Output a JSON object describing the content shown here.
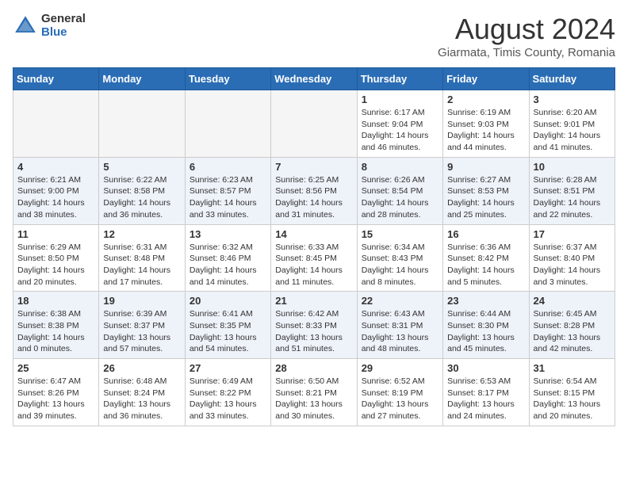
{
  "header": {
    "logo": {
      "general": "General",
      "blue": "Blue"
    },
    "month_year": "August 2024",
    "location": "Giarmata, Timis County, Romania"
  },
  "weekdays": [
    "Sunday",
    "Monday",
    "Tuesday",
    "Wednesday",
    "Thursday",
    "Friday",
    "Saturday"
  ],
  "weeks": [
    [
      {
        "day": "",
        "info": ""
      },
      {
        "day": "",
        "info": ""
      },
      {
        "day": "",
        "info": ""
      },
      {
        "day": "",
        "info": ""
      },
      {
        "day": "1",
        "info": "Sunrise: 6:17 AM\nSunset: 9:04 PM\nDaylight: 14 hours\nand 46 minutes."
      },
      {
        "day": "2",
        "info": "Sunrise: 6:19 AM\nSunset: 9:03 PM\nDaylight: 14 hours\nand 44 minutes."
      },
      {
        "day": "3",
        "info": "Sunrise: 6:20 AM\nSunset: 9:01 PM\nDaylight: 14 hours\nand 41 minutes."
      }
    ],
    [
      {
        "day": "4",
        "info": "Sunrise: 6:21 AM\nSunset: 9:00 PM\nDaylight: 14 hours\nand 38 minutes."
      },
      {
        "day": "5",
        "info": "Sunrise: 6:22 AM\nSunset: 8:58 PM\nDaylight: 14 hours\nand 36 minutes."
      },
      {
        "day": "6",
        "info": "Sunrise: 6:23 AM\nSunset: 8:57 PM\nDaylight: 14 hours\nand 33 minutes."
      },
      {
        "day": "7",
        "info": "Sunrise: 6:25 AM\nSunset: 8:56 PM\nDaylight: 14 hours\nand 31 minutes."
      },
      {
        "day": "8",
        "info": "Sunrise: 6:26 AM\nSunset: 8:54 PM\nDaylight: 14 hours\nand 28 minutes."
      },
      {
        "day": "9",
        "info": "Sunrise: 6:27 AM\nSunset: 8:53 PM\nDaylight: 14 hours\nand 25 minutes."
      },
      {
        "day": "10",
        "info": "Sunrise: 6:28 AM\nSunset: 8:51 PM\nDaylight: 14 hours\nand 22 minutes."
      }
    ],
    [
      {
        "day": "11",
        "info": "Sunrise: 6:29 AM\nSunset: 8:50 PM\nDaylight: 14 hours\nand 20 minutes."
      },
      {
        "day": "12",
        "info": "Sunrise: 6:31 AM\nSunset: 8:48 PM\nDaylight: 14 hours\nand 17 minutes."
      },
      {
        "day": "13",
        "info": "Sunrise: 6:32 AM\nSunset: 8:46 PM\nDaylight: 14 hours\nand 14 minutes."
      },
      {
        "day": "14",
        "info": "Sunrise: 6:33 AM\nSunset: 8:45 PM\nDaylight: 14 hours\nand 11 minutes."
      },
      {
        "day": "15",
        "info": "Sunrise: 6:34 AM\nSunset: 8:43 PM\nDaylight: 14 hours\nand 8 minutes."
      },
      {
        "day": "16",
        "info": "Sunrise: 6:36 AM\nSunset: 8:42 PM\nDaylight: 14 hours\nand 5 minutes."
      },
      {
        "day": "17",
        "info": "Sunrise: 6:37 AM\nSunset: 8:40 PM\nDaylight: 14 hours\nand 3 minutes."
      }
    ],
    [
      {
        "day": "18",
        "info": "Sunrise: 6:38 AM\nSunset: 8:38 PM\nDaylight: 14 hours\nand 0 minutes."
      },
      {
        "day": "19",
        "info": "Sunrise: 6:39 AM\nSunset: 8:37 PM\nDaylight: 13 hours\nand 57 minutes."
      },
      {
        "day": "20",
        "info": "Sunrise: 6:41 AM\nSunset: 8:35 PM\nDaylight: 13 hours\nand 54 minutes."
      },
      {
        "day": "21",
        "info": "Sunrise: 6:42 AM\nSunset: 8:33 PM\nDaylight: 13 hours\nand 51 minutes."
      },
      {
        "day": "22",
        "info": "Sunrise: 6:43 AM\nSunset: 8:31 PM\nDaylight: 13 hours\nand 48 minutes."
      },
      {
        "day": "23",
        "info": "Sunrise: 6:44 AM\nSunset: 8:30 PM\nDaylight: 13 hours\nand 45 minutes."
      },
      {
        "day": "24",
        "info": "Sunrise: 6:45 AM\nSunset: 8:28 PM\nDaylight: 13 hours\nand 42 minutes."
      }
    ],
    [
      {
        "day": "25",
        "info": "Sunrise: 6:47 AM\nSunset: 8:26 PM\nDaylight: 13 hours\nand 39 minutes."
      },
      {
        "day": "26",
        "info": "Sunrise: 6:48 AM\nSunset: 8:24 PM\nDaylight: 13 hours\nand 36 minutes."
      },
      {
        "day": "27",
        "info": "Sunrise: 6:49 AM\nSunset: 8:22 PM\nDaylight: 13 hours\nand 33 minutes."
      },
      {
        "day": "28",
        "info": "Sunrise: 6:50 AM\nSunset: 8:21 PM\nDaylight: 13 hours\nand 30 minutes."
      },
      {
        "day": "29",
        "info": "Sunrise: 6:52 AM\nSunset: 8:19 PM\nDaylight: 13 hours\nand 27 minutes."
      },
      {
        "day": "30",
        "info": "Sunrise: 6:53 AM\nSunset: 8:17 PM\nDaylight: 13 hours\nand 24 minutes."
      },
      {
        "day": "31",
        "info": "Sunrise: 6:54 AM\nSunset: 8:15 PM\nDaylight: 13 hours\nand 20 minutes."
      }
    ]
  ]
}
